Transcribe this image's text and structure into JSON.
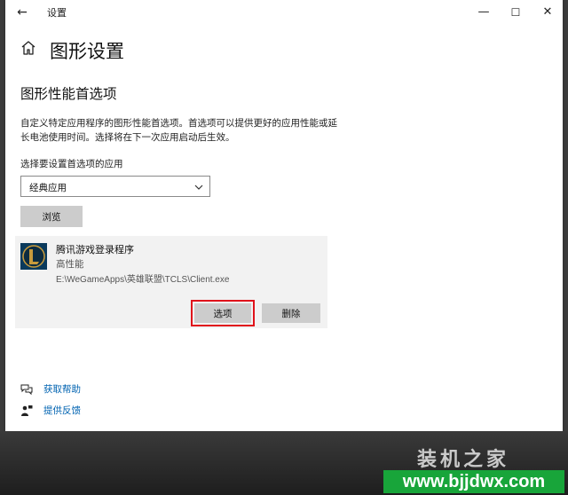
{
  "window": {
    "title": "设置",
    "back_glyph": "←",
    "minimize_glyph": "—",
    "maximize_glyph": "☐",
    "close_glyph": "✕"
  },
  "page": {
    "title": "图形设置",
    "section_title": "图形性能首选项",
    "description": "自定义特定应用程序的图形性能首选项。首选项可以提供更好的应用性能或延长电池使用时间。选择将在下一次应用启动后生效。",
    "choose_label": "选择要设置首选项的应用",
    "app_type_selected": "经典应用",
    "browse_label": "浏览"
  },
  "app_card": {
    "name": "腾讯游戏登录程序",
    "preference": "高性能",
    "path": "E:\\WeGameApps\\英雄联盟\\TCLS\\Client.exe",
    "options_label": "选项",
    "delete_label": "删除"
  },
  "links": {
    "help": "获取帮助",
    "feedback": "提供反馈"
  },
  "watermark": {
    "brand": "装机之家",
    "url": "www.bjjdwx.com"
  },
  "colors": {
    "link": "#0063b1",
    "highlight_border": "#e0121b",
    "button_bg": "#cccccc",
    "card_bg": "#f2f2f2"
  },
  "icons": {
    "back": "back-arrow-icon",
    "home": "home-icon",
    "dropdown": "chevron-down-icon",
    "app": "league-of-legends-icon",
    "help": "help-chat-icon",
    "feedback": "feedback-person-icon"
  }
}
